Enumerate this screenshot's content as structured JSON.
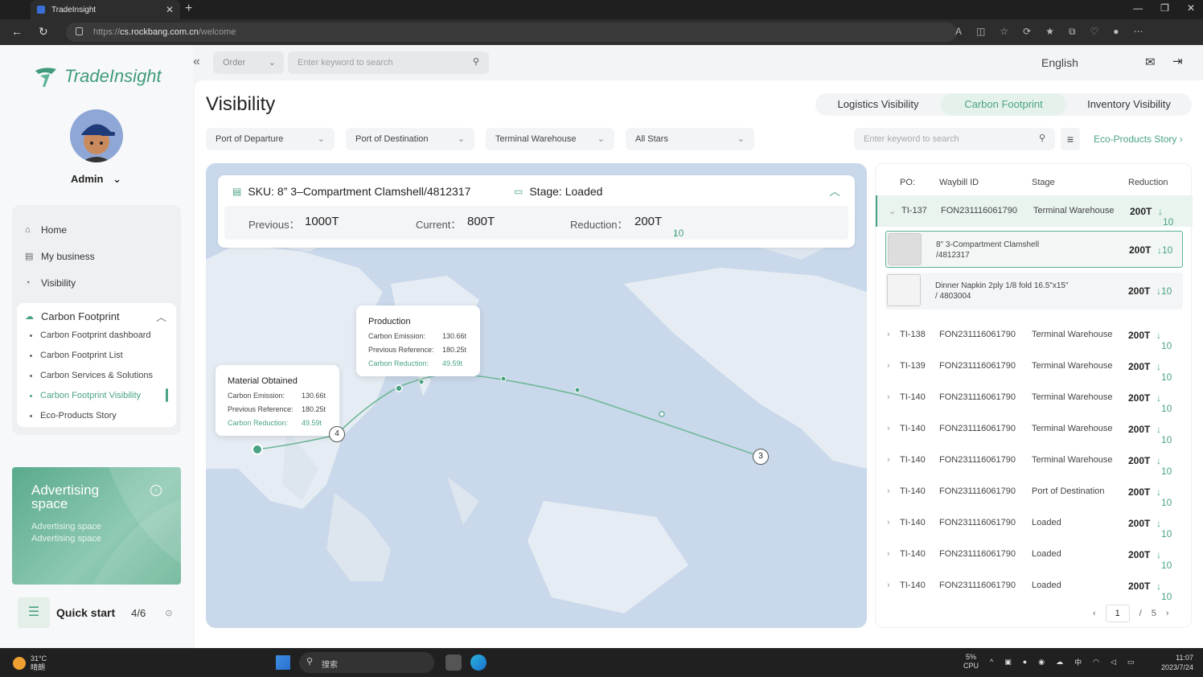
{
  "browser": {
    "tab_title": "TradeInsight",
    "url_prefix": "https://",
    "url_domain": "cs.rockbang.com.cn",
    "url_path": "/welcome"
  },
  "sidebar": {
    "logo": "TradeInsight",
    "user": "Admin",
    "menu": [
      {
        "label": "Home",
        "icon": "home-icon"
      },
      {
        "label": "My business",
        "icon": "clipboard-icon"
      },
      {
        "label": "Visibility",
        "icon": "pie-chart-icon"
      }
    ],
    "section": {
      "label": "Carbon Footprint",
      "icon": "cloud-icon"
    },
    "submenu": [
      {
        "label": "Carbon Footprint dashboard"
      },
      {
        "label": "Carbon Footprint List"
      },
      {
        "label": "Carbon Services & Solutions"
      },
      {
        "label": "Carbon Footprint Visibility"
      },
      {
        "label": "Eco-Products Story"
      }
    ],
    "ad": {
      "title": "Advertising space",
      "text": "Advertising space Advertising space"
    },
    "quick_start": {
      "label": "Quick start",
      "count": "4/6"
    }
  },
  "topbar": {
    "order_select": "Order",
    "search_placeholder": "Enter keyword to search",
    "language": "English"
  },
  "main": {
    "title": "Visibility",
    "tabs": [
      "Logistics Visibility",
      "Carbon Footprint",
      "Inventory Visibility"
    ],
    "active_tab": "Carbon Footprint",
    "filters": [
      "Port of Departure",
      "Port of Destination",
      "Terminal Warehouse",
      "All Stars"
    ],
    "search_placeholder": "Enter keyword to search",
    "eco_link": "Eco-Products Story"
  },
  "sku_card": {
    "sku": "SKU: 8” 3–Compartment Clamshell/4812317",
    "stage": "Stage: Loaded",
    "previous_label": "Previous：",
    "previous": "1000T",
    "current_label": "Current：",
    "current": "800T",
    "reduction_label": "Reduction：",
    "reduction": "200T",
    "reduction_delta": "10"
  },
  "map": {
    "production": {
      "title": "Production",
      "rows": [
        {
          "label": "Carbon Emission:",
          "value": "130.66t"
        },
        {
          "label": "Previous Reference:",
          "value": "180.25t"
        },
        {
          "label": "Carbon Reduction:",
          "value": "49.59t"
        }
      ]
    },
    "material": {
      "title": "Material Obtained",
      "rows": [
        {
          "label": "Carbon Emission:",
          "value": "130.66t"
        },
        {
          "label": "Previous Reference:",
          "value": "180.25t"
        },
        {
          "label": "Carbon Reduction:",
          "value": "49.59t"
        }
      ]
    },
    "markers": [
      "4",
      "3"
    ]
  },
  "table": {
    "headers": [
      "PO:",
      "Waybill ID",
      "Stage",
      "Reduction"
    ],
    "expanded": {
      "po": "TI-137",
      "waybill": "FON231116061790",
      "stage": "Terminal Warehouse",
      "reduction": "200T",
      "delta": "10"
    },
    "products": [
      {
        "name": "8\" 3-Compartment Clamshell /4812317",
        "reduction": "200T",
        "delta": "10"
      },
      {
        "name": "Dinner Napkin 2ply 1/8 fold 16.5\"x15\" / 4803004",
        "reduction": "200T",
        "delta": "10"
      }
    ],
    "rows": [
      {
        "po": "TI-138",
        "waybill": "FON231116061790",
        "stage": "Terminal Warehouse",
        "reduction": "200T",
        "delta": "10"
      },
      {
        "po": "TI-139",
        "waybill": "FON231116061790",
        "stage": "Terminal Warehouse",
        "reduction": "200T",
        "delta": "10"
      },
      {
        "po": "TI-140",
        "waybill": "FON231116061790",
        "stage": "Terminal Warehouse",
        "reduction": "200T",
        "delta": "10"
      },
      {
        "po": "TI-140",
        "waybill": "FON231116061790",
        "stage": "Terminal Warehouse",
        "reduction": "200T",
        "delta": "10"
      },
      {
        "po": "TI-140",
        "waybill": "FON231116061790",
        "stage": "Terminal Warehouse",
        "reduction": "200T",
        "delta": "10"
      },
      {
        "po": "TI-140",
        "waybill": "FON231116061790",
        "stage": "Port of Destination",
        "reduction": "200T",
        "delta": "10"
      },
      {
        "po": "TI-140",
        "waybill": "FON231116061790",
        "stage": "Loaded",
        "reduction": "200T",
        "delta": "10"
      },
      {
        "po": "TI-140",
        "waybill": "FON231116061790",
        "stage": "Loaded",
        "reduction": "200T",
        "delta": "10"
      },
      {
        "po": "TI-140",
        "waybill": "FON231116061790",
        "stage": "Loaded",
        "reduction": "200T",
        "delta": "10"
      }
    ],
    "pager": {
      "current": "1",
      "separator": "/",
      "total": "5"
    }
  },
  "taskbar": {
    "temp": "31°C",
    "weather": "晴朗",
    "search": "搜索",
    "cpu_pct": "5%",
    "cpu": "CPU",
    "ime": "中",
    "time": "11:07",
    "date": "2023/7/24"
  },
  "colors": {
    "accent": "#4aa383",
    "map_bg": "#c9d8ea"
  }
}
